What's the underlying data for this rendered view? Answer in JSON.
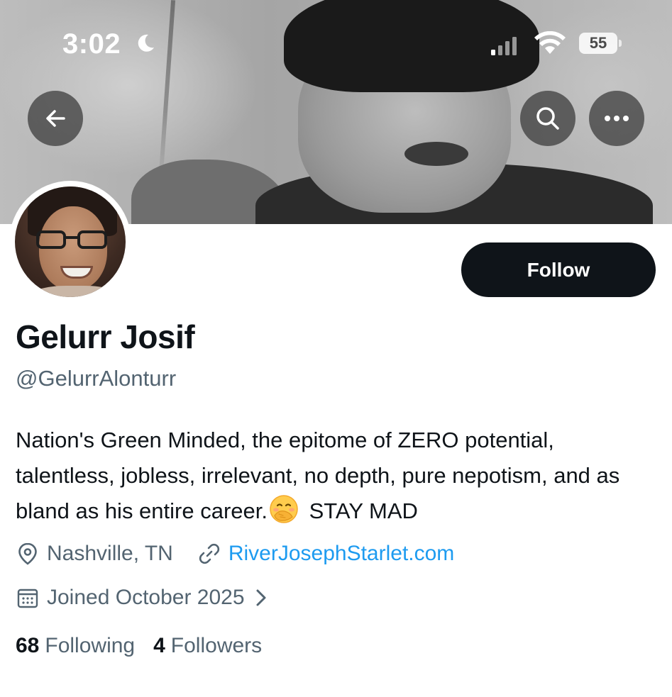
{
  "status_bar": {
    "time": "3:02",
    "battery": "55"
  },
  "header": {
    "back_icon": "arrow-left-icon",
    "search_icon": "search-icon",
    "more_icon": "more-horizontal-icon"
  },
  "profile": {
    "follow_label": "Follow",
    "display_name": "Gelurr Josif",
    "handle": "@GelurrAlonturr",
    "bio_text": "Nation's Green Minded, the epitome of ZERO potential, talentless, jobless, irrelevant, no depth, pure nepotism, and as bland as his entire career.",
    "bio_emoji": "face-with-hand-over-mouth-emoji",
    "bio_tail": "STAY MAD",
    "location": "Nashville, TN",
    "website": "RiverJosephStarlet.com",
    "joined": "Joined October 2025",
    "following_count": "68",
    "following_label": "Following",
    "followers_count": "4",
    "followers_label": "Followers"
  },
  "colors": {
    "accent": "#1d9bf0",
    "secondary_text": "#536471",
    "primary_text": "#0f1419",
    "follow_button": "#0f1419"
  }
}
